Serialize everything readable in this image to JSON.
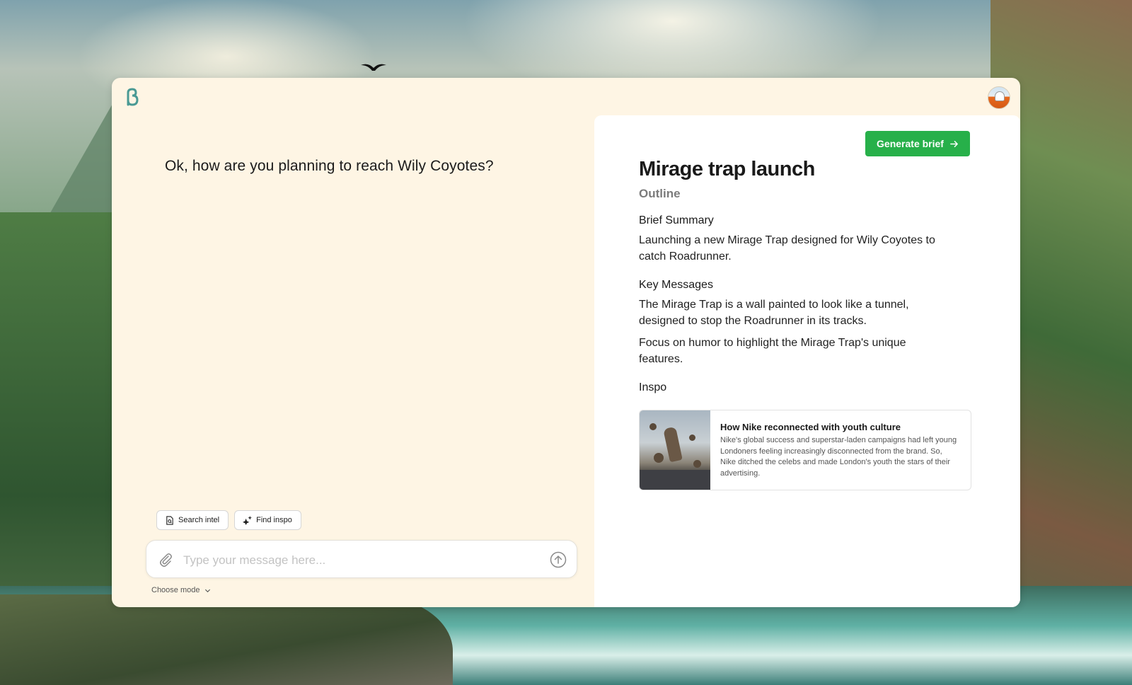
{
  "chat": {
    "question": "Ok, how are you planning to reach Wily Coyotes?"
  },
  "actions": {
    "search_intel": "Search intel",
    "find_inspo": "Find inspo"
  },
  "composer": {
    "placeholder": "Type your message here...",
    "value": ""
  },
  "mode": {
    "label": "Choose mode"
  },
  "brief": {
    "generate_label": "Generate brief",
    "title": "Mirage trap launch",
    "subtitle": "Outline",
    "sections": [
      {
        "heading": "Brief Summary",
        "paragraphs": [
          "Launching a new Mirage Trap designed for Wily Coyotes to catch Roadrunner."
        ]
      },
      {
        "heading": "Key Messages",
        "paragraphs": [
          "The Mirage Trap is a wall painted to look like a tunnel, designed to stop the Roadrunner in its tracks.",
          "Focus on humor to highlight the Mirage Trap's unique features."
        ]
      },
      {
        "heading": "Inspo",
        "paragraphs": []
      }
    ],
    "inspo": {
      "title": "How Nike reconnected with youth culture",
      "description": "Nike's global success and superstar-laden campaigns had left young Londoners feeling increasingly disconnected from the brand. So, Nike ditched the celebs and made London's youth the stars of their advertising."
    }
  },
  "colors": {
    "accent": "#27b04a",
    "window_bg": "#fef5e4",
    "logo": "#4a9a94"
  },
  "icons": {
    "logo": "brand-logo-icon",
    "avatar": "user-avatar",
    "search_intel": "document-search-icon",
    "find_inspo": "sparkle-icon",
    "attach": "paperclip-icon",
    "send": "arrow-up-circle-icon",
    "mode": "chevron-down-icon",
    "generate": "arrow-right-icon"
  }
}
